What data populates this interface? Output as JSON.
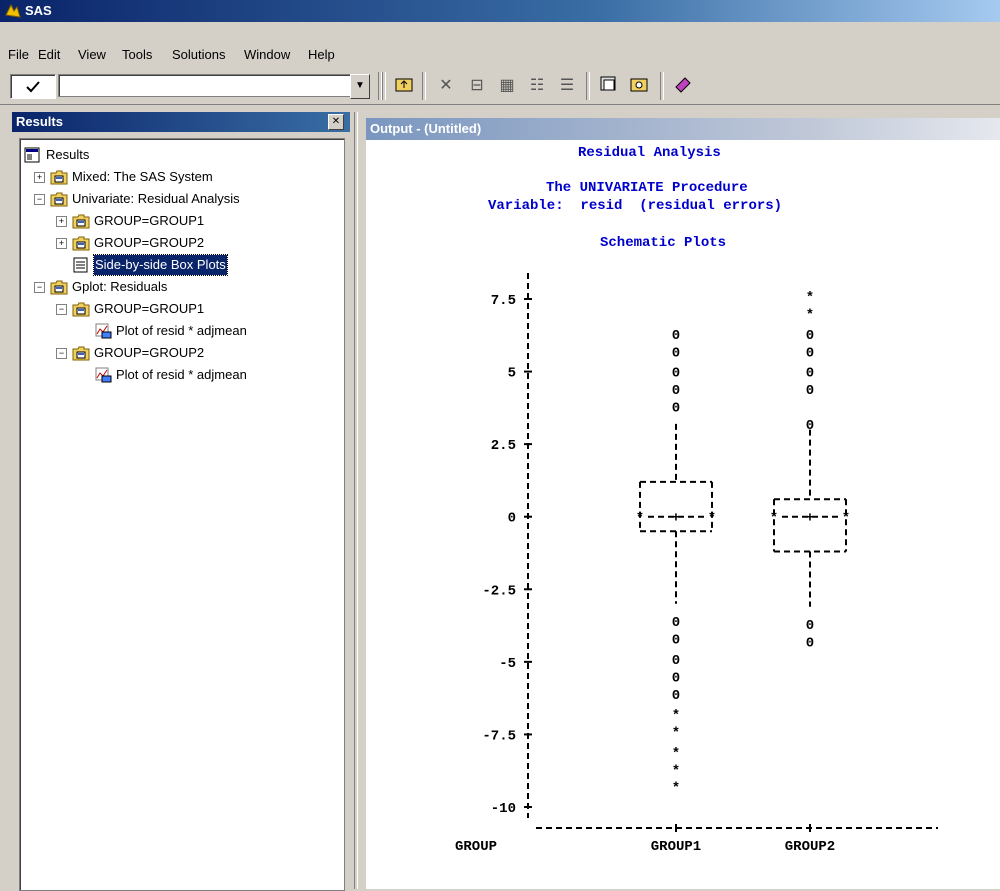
{
  "window": {
    "title": "SAS"
  },
  "menu": [
    "File",
    "Edit",
    "View",
    "Tools",
    "Solutions",
    "Window",
    "Help"
  ],
  "toolbar": {
    "command_value": "",
    "check_icon": "checkmark-icon"
  },
  "results": {
    "title": "Results",
    "tree": [
      {
        "label": "Results",
        "level": 0,
        "expander": "",
        "icon": "results-icon"
      },
      {
        "label": "Mixed:  The SAS System",
        "level": 1,
        "expander": "+",
        "icon": "folder-icon"
      },
      {
        "label": "Univariate:  Residual Analysis",
        "level": 1,
        "expander": "-",
        "icon": "folder-icon"
      },
      {
        "label": "GROUP=GROUP1",
        "level": 2,
        "expander": "+",
        "icon": "folder-icon"
      },
      {
        "label": "GROUP=GROUP2",
        "level": 2,
        "expander": "+",
        "icon": "folder-icon"
      },
      {
        "label": "Side-by-side Box Plots",
        "level": 2,
        "expander": "",
        "icon": "document-icon",
        "selected": true
      },
      {
        "label": "Gplot:  Residuals",
        "level": 1,
        "expander": "-",
        "icon": "folder-icon"
      },
      {
        "label": "GROUP=GROUP1",
        "level": 2,
        "expander": "-",
        "icon": "folder-icon"
      },
      {
        "label": "Plot of resid * adjmean",
        "level": 3,
        "expander": "",
        "icon": "graph-icon"
      },
      {
        "label": "GROUP=GROUP2",
        "level": 2,
        "expander": "-",
        "icon": "folder-icon"
      },
      {
        "label": "Plot of resid * adjmean",
        "level": 3,
        "expander": "",
        "icon": "graph-icon"
      }
    ]
  },
  "output": {
    "title": "Output - (Untitled)",
    "heading1": "Residual Analysis",
    "heading2": "The UNIVARIATE Procedure",
    "heading3": "Variable:  resid  (residual errors)",
    "heading4": "Schematic Plots",
    "axis_ticks": [
      "7.5",
      "5",
      "2.5",
      "0",
      "-2.5",
      "-5",
      "-7.5",
      "-10"
    ],
    "group_label": "GROUP",
    "groups": [
      "GROUP1",
      "GROUP2"
    ]
  },
  "chart_data": {
    "type": "box",
    "title": "Schematic Plots",
    "xlabel": "GROUP",
    "ylabel": "",
    "ylim": [
      -10,
      8.5
    ],
    "yticks": [
      7.5,
      5,
      2.5,
      0,
      -2.5,
      -5,
      -7.5,
      -10
    ],
    "series": [
      {
        "name": "GROUP1",
        "q1": -0.5,
        "median": 0,
        "q3": 1.2,
        "mean": 0,
        "whisker_low": -3.0,
        "whisker_high": 3.2,
        "outliers_o": [
          6.3,
          5.7,
          5.0,
          4.4,
          3.8,
          -3.6,
          -4.2,
          -4.9,
          -5.5,
          -6.1
        ],
        "outliers_star": [
          -6.8,
          -7.4,
          -8.1,
          -8.7,
          -9.3
        ]
      },
      {
        "name": "GROUP2",
        "q1": -1.2,
        "median": 0,
        "q3": 0.6,
        "mean": 0,
        "whisker_low": -3.1,
        "whisker_high": 3.0,
        "outliers_o": [
          6.3,
          5.7,
          5.0,
          4.4,
          3.2,
          -3.7,
          -4.3
        ],
        "outliers_star": [
          7.6,
          7.0
        ]
      }
    ]
  }
}
